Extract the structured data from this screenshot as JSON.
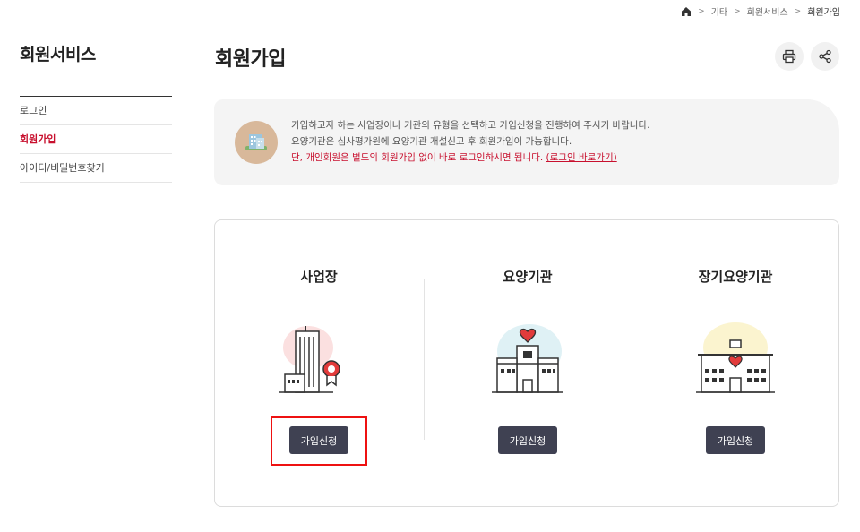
{
  "breadcrumb": {
    "items": [
      "기타",
      "회원서비스",
      "회원가입"
    ]
  },
  "sidebar": {
    "title": "회원서비스",
    "items": [
      {
        "label": "로그인",
        "active": false
      },
      {
        "label": "회원가입",
        "active": true
      },
      {
        "label": "아이디/비밀번호찾기",
        "active": false
      }
    ]
  },
  "main": {
    "title": "회원가입",
    "notice": {
      "line1": "가입하고자 하는 사업장이나 기관의 유형을 선택하고 가입신청을 진행하여 주시기 바랍니다.",
      "line2": "요양기관은 심사평가원에 요양기관 개설신고 후 회원가입이 가능합니다.",
      "line3": "단, 개인회원은 별도의 회원가입 없이 바로 로그인하시면 됩니다.",
      "login_link": "(로그인 바로가기)"
    },
    "cards": [
      {
        "title": "사업장",
        "button": "가입신청"
      },
      {
        "title": "요양기관",
        "button": "가입신청"
      },
      {
        "title": "장기요양기관",
        "button": "가입신청"
      }
    ]
  },
  "colors": {
    "accent": "#c8102e",
    "button": "#3f4152",
    "highlight": "#e11111"
  }
}
